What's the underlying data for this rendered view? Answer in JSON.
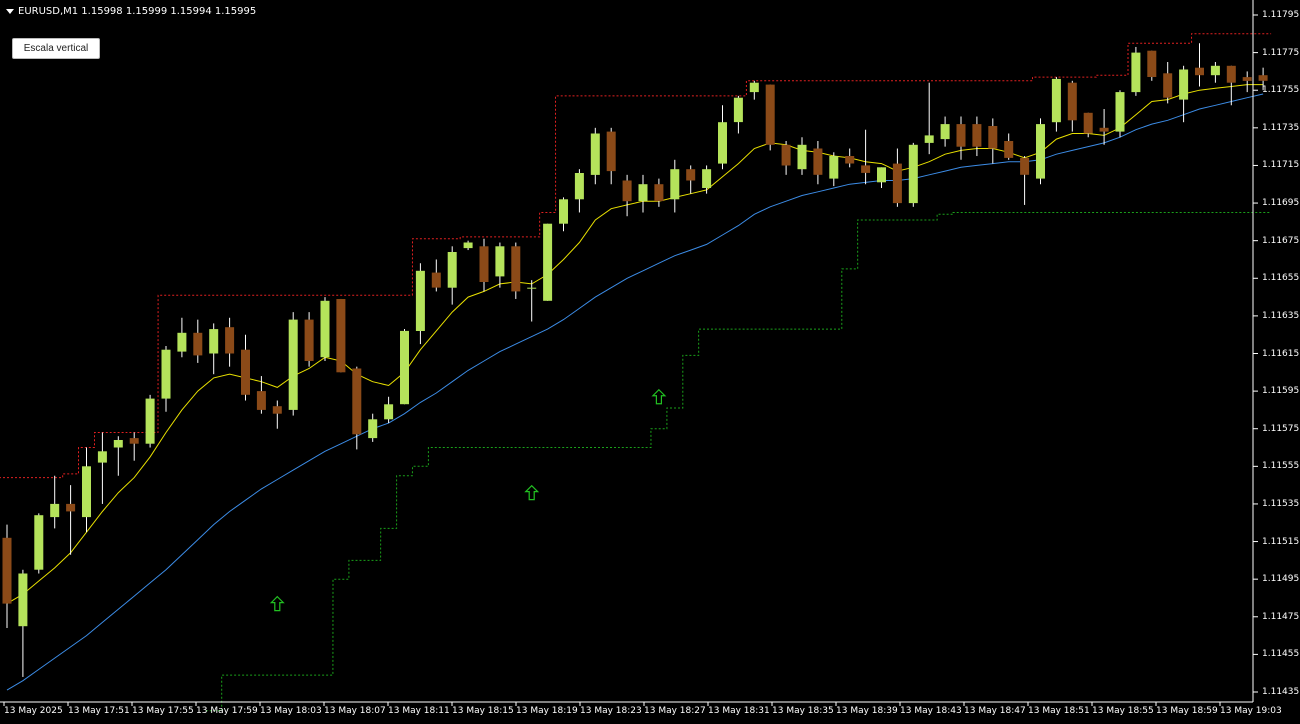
{
  "window": {
    "symbol_header": "EURUSD,M1  1.15998 1.15999 1.15994 1.15995"
  },
  "buttons": {
    "vertical_scale": "Escala vertical"
  },
  "colors": {
    "background": "#000000",
    "bull_candle": "#b5e35b",
    "bear_candle": "#8b4a18",
    "fast_ma": "#e8e000",
    "slow_ma": "#3c8ce6",
    "resistance": "#e02020",
    "support": "#1aa01a",
    "arrow": "#22c022",
    "axis": "#ffffff"
  },
  "price_axis": {
    "labels": [
      "1.11795",
      "1.11775",
      "1.11755",
      "1.11735",
      "1.11715",
      "1.11695",
      "1.11675",
      "1.11655",
      "1.11635",
      "1.11615",
      "1.11595",
      "1.11575",
      "1.11555",
      "1.11535",
      "1.11515",
      "1.11495",
      "1.11475",
      "1.11455",
      "1.11435"
    ]
  },
  "time_axis": {
    "labels": [
      "13 May 2025",
      "13 May 17:51",
      "13 May 17:55",
      "13 May 17:59",
      "13 May 18:03",
      "13 May 18:07",
      "13 May 18:11",
      "13 May 18:15",
      "13 May 18:19",
      "13 May 18:23",
      "13 May 18:27",
      "13 May 18:31",
      "13 May 18:35",
      "13 May 18:39",
      "13 May 18:43",
      "13 May 18:47",
      "13 May 18:51",
      "13 May 18:55",
      "13 May 18:59",
      "13 May 19:03"
    ]
  },
  "chart_data": {
    "type": "candlestick",
    "symbol": "EURUSD",
    "timeframe": "M1",
    "ylim": [
      1.1143,
      1.118
    ],
    "candles": [
      {
        "o": 1.11517,
        "h": 1.11524,
        "l": 1.11469,
        "c": 1.11482
      },
      {
        "o": 1.1147,
        "h": 1.115,
        "l": 1.11443,
        "c": 1.11498
      },
      {
        "o": 1.115,
        "h": 1.1153,
        "l": 1.11498,
        "c": 1.11529
      },
      {
        "o": 1.11528,
        "h": 1.1155,
        "l": 1.11522,
        "c": 1.11535
      },
      {
        "o": 1.11535,
        "h": 1.11545,
        "l": 1.11508,
        "c": 1.11531
      },
      {
        "o": 1.11528,
        "h": 1.11565,
        "l": 1.1152,
        "c": 1.11555
      },
      {
        "o": 1.11557,
        "h": 1.11573,
        "l": 1.11535,
        "c": 1.11563
      },
      {
        "o": 1.11565,
        "h": 1.11571,
        "l": 1.1155,
        "c": 1.11569
      },
      {
        "o": 1.1157,
        "h": 1.11573,
        "l": 1.11558,
        "c": 1.11567
      },
      {
        "o": 1.11567,
        "h": 1.11593,
        "l": 1.11565,
        "c": 1.11591
      },
      {
        "o": 1.11591,
        "h": 1.11619,
        "l": 1.11584,
        "c": 1.11617
      },
      {
        "o": 1.11616,
        "h": 1.11634,
        "l": 1.11613,
        "c": 1.11626
      },
      {
        "o": 1.11626,
        "h": 1.11633,
        "l": 1.1161,
        "c": 1.11614
      },
      {
        "o": 1.11615,
        "h": 1.11631,
        "l": 1.11604,
        "c": 1.11628
      },
      {
        "o": 1.11629,
        "h": 1.11634,
        "l": 1.11608,
        "c": 1.11615
      },
      {
        "o": 1.11617,
        "h": 1.11625,
        "l": 1.1159,
        "c": 1.11593
      },
      {
        "o": 1.11595,
        "h": 1.11603,
        "l": 1.11583,
        "c": 1.11585
      },
      {
        "o": 1.11587,
        "h": 1.1159,
        "l": 1.11575,
        "c": 1.11583
      },
      {
        "o": 1.11585,
        "h": 1.11637,
        "l": 1.11582,
        "c": 1.11633
      },
      {
        "o": 1.11633,
        "h": 1.11637,
        "l": 1.11608,
        "c": 1.11611
      },
      {
        "o": 1.11613,
        "h": 1.11645,
        "l": 1.11611,
        "c": 1.11643
      },
      {
        "o": 1.11644,
        "h": 1.11644,
        "l": 1.11605,
        "c": 1.11605
      },
      {
        "o": 1.11607,
        "h": 1.11608,
        "l": 1.11564,
        "c": 1.11572
      },
      {
        "o": 1.1157,
        "h": 1.11583,
        "l": 1.11568,
        "c": 1.1158
      },
      {
        "o": 1.1158,
        "h": 1.11592,
        "l": 1.11578,
        "c": 1.11588
      },
      {
        "o": 1.11588,
        "h": 1.11628,
        "l": 1.11588,
        "c": 1.11627
      },
      {
        "o": 1.11627,
        "h": 1.11663,
        "l": 1.1162,
        "c": 1.11659
      },
      {
        "o": 1.11658,
        "h": 1.11665,
        "l": 1.11648,
        "c": 1.1165
      },
      {
        "o": 1.1165,
        "h": 1.11672,
        "l": 1.11641,
        "c": 1.11669
      },
      {
        "o": 1.11671,
        "h": 1.11675,
        "l": 1.1167,
        "c": 1.11674
      },
      {
        "o": 1.11672,
        "h": 1.11676,
        "l": 1.11648,
        "c": 1.11653
      },
      {
        "o": 1.11656,
        "h": 1.11674,
        "l": 1.1165,
        "c": 1.11672
      },
      {
        "o": 1.11672,
        "h": 1.11674,
        "l": 1.11644,
        "c": 1.11648
      },
      {
        "o": 1.1165,
        "h": 1.11654,
        "l": 1.11632,
        "c": 1.1165
      },
      {
        "o": 1.11643,
        "h": 1.11684,
        "l": 1.11643,
        "c": 1.11684
      },
      {
        "o": 1.11684,
        "h": 1.11698,
        "l": 1.1168,
        "c": 1.11697
      },
      {
        "o": 1.11697,
        "h": 1.11713,
        "l": 1.1169,
        "c": 1.11711
      },
      {
        "o": 1.1171,
        "h": 1.11735,
        "l": 1.11705,
        "c": 1.11732
      },
      {
        "o": 1.11733,
        "h": 1.11735,
        "l": 1.11705,
        "c": 1.11712
      },
      {
        "o": 1.11707,
        "h": 1.1171,
        "l": 1.11688,
        "c": 1.11696
      },
      {
        "o": 1.11696,
        "h": 1.1171,
        "l": 1.1169,
        "c": 1.11705
      },
      {
        "o": 1.11705,
        "h": 1.11708,
        "l": 1.11693,
        "c": 1.11696
      },
      {
        "o": 1.11697,
        "h": 1.11718,
        "l": 1.1169,
        "c": 1.11713
      },
      {
        "o": 1.11713,
        "h": 1.11715,
        "l": 1.117,
        "c": 1.11707
      },
      {
        "o": 1.11703,
        "h": 1.11715,
        "l": 1.117,
        "c": 1.11713
      },
      {
        "o": 1.11716,
        "h": 1.11747,
        "l": 1.11713,
        "c": 1.11738
      },
      {
        "o": 1.11738,
        "h": 1.11752,
        "l": 1.11732,
        "c": 1.11751
      },
      {
        "o": 1.11754,
        "h": 1.1176,
        "l": 1.1175,
        "c": 1.11759
      },
      {
        "o": 1.11758,
        "h": 1.11758,
        "l": 1.11723,
        "c": 1.11726
      },
      {
        "o": 1.11726,
        "h": 1.11728,
        "l": 1.1171,
        "c": 1.11715
      },
      {
        "o": 1.11713,
        "h": 1.1173,
        "l": 1.1171,
        "c": 1.11726
      },
      {
        "o": 1.11724,
        "h": 1.11728,
        "l": 1.11705,
        "c": 1.1171
      },
      {
        "o": 1.11708,
        "h": 1.11722,
        "l": 1.11704,
        "c": 1.1172
      },
      {
        "o": 1.1172,
        "h": 1.11724,
        "l": 1.11714,
        "c": 1.11716
      },
      {
        "o": 1.11715,
        "h": 1.11734,
        "l": 1.11705,
        "c": 1.11711
      },
      {
        "o": 1.11706,
        "h": 1.11714,
        "l": 1.11703,
        "c": 1.11714
      },
      {
        "o": 1.11716,
        "h": 1.11724,
        "l": 1.11693,
        "c": 1.11695
      },
      {
        "o": 1.11695,
        "h": 1.11727,
        "l": 1.11693,
        "c": 1.11726
      },
      {
        "o": 1.11727,
        "h": 1.11759,
        "l": 1.11721,
        "c": 1.11731
      },
      {
        "o": 1.11729,
        "h": 1.11741,
        "l": 1.11725,
        "c": 1.11737
      },
      {
        "o": 1.11737,
        "h": 1.11741,
        "l": 1.11718,
        "c": 1.11725
      },
      {
        "o": 1.11737,
        "h": 1.11741,
        "l": 1.1172,
        "c": 1.11725
      },
      {
        "o": 1.11736,
        "h": 1.1174,
        "l": 1.11716,
        "c": 1.11724
      },
      {
        "o": 1.11728,
        "h": 1.11732,
        "l": 1.11718,
        "c": 1.11719
      },
      {
        "o": 1.11719,
        "h": 1.1172,
        "l": 1.11694,
        "c": 1.1171
      },
      {
        "o": 1.11708,
        "h": 1.1174,
        "l": 1.11705,
        "c": 1.11737
      },
      {
        "o": 1.11738,
        "h": 1.11762,
        "l": 1.11733,
        "c": 1.11761
      },
      {
        "o": 1.11759,
        "h": 1.1176,
        "l": 1.11733,
        "c": 1.11739
      },
      {
        "o": 1.11743,
        "h": 1.11743,
        "l": 1.1173,
        "c": 1.11732
      },
      {
        "o": 1.11735,
        "h": 1.11745,
        "l": 1.11726,
        "c": 1.11733
      },
      {
        "o": 1.11733,
        "h": 1.11755,
        "l": 1.1173,
        "c": 1.11754
      },
      {
        "o": 1.11754,
        "h": 1.11778,
        "l": 1.11752,
        "c": 1.11775
      },
      {
        "o": 1.11776,
        "h": 1.11776,
        "l": 1.1176,
        "c": 1.11762
      },
      {
        "o": 1.11764,
        "h": 1.1177,
        "l": 1.11748,
        "c": 1.11751
      },
      {
        "o": 1.1175,
        "h": 1.11768,
        "l": 1.11738,
        "c": 1.11766
      },
      {
        "o": 1.11767,
        "h": 1.1178,
        "l": 1.11757,
        "c": 1.11763
      },
      {
        "o": 1.11763,
        "h": 1.1177,
        "l": 1.11759,
        "c": 1.11768
      },
      {
        "o": 1.11768,
        "h": 1.11768,
        "l": 1.11747,
        "c": 1.11759
      },
      {
        "o": 1.11762,
        "h": 1.11765,
        "l": 1.11754,
        "c": 1.1176
      },
      {
        "o": 1.11763,
        "h": 1.11767,
        "l": 1.11755,
        "c": 1.1176
      }
    ],
    "fast_ma": [
      1.11482,
      1.11487,
      1.11494,
      1.11501,
      1.11509,
      1.1152,
      1.11531,
      1.11541,
      1.11549,
      1.1156,
      1.11573,
      1.11585,
      1.11595,
      1.11602,
      1.11604,
      1.11602,
      1.116,
      1.11597,
      1.11603,
      1.11607,
      1.11613,
      1.11611,
      1.11604,
      1.116,
      1.11598,
      1.11605,
      1.11617,
      1.11627,
      1.11637,
      1.11645,
      1.11648,
      1.11652,
      1.11653,
      1.11652,
      1.11657,
      1.11665,
      1.11674,
      1.11686,
      1.11692,
      1.11694,
      1.11696,
      1.11696,
      1.11698,
      1.117,
      1.11702,
      1.11709,
      1.11716,
      1.11724,
      1.11727,
      1.11726,
      1.11723,
      1.11722,
      1.1172,
      1.11719,
      1.11717,
      1.11716,
      1.11712,
      1.11714,
      1.11717,
      1.11721,
      1.11723,
      1.11724,
      1.11724,
      1.11722,
      1.11719,
      1.11722,
      1.11729,
      1.11732,
      1.11732,
      1.11731,
      1.11735,
      1.11742,
      1.11749,
      1.1175,
      1.11753,
      1.11755,
      1.11756,
      1.11757,
      1.11758,
      1.11758
    ],
    "slow_ma": [
      1.11436,
      1.11441,
      1.11447,
      1.11453,
      1.11459,
      1.11465,
      1.11472,
      1.11479,
      1.11486,
      1.11493,
      1.115,
      1.11508,
      1.11516,
      1.11524,
      1.11531,
      1.11537,
      1.11543,
      1.11548,
      1.11553,
      1.11558,
      1.11563,
      1.11567,
      1.11571,
      1.11575,
      1.11578,
      1.11583,
      1.11589,
      1.11594,
      1.116,
      1.11606,
      1.11611,
      1.11616,
      1.1162,
      1.11624,
      1.11628,
      1.11633,
      1.11639,
      1.11645,
      1.1165,
      1.11655,
      1.11659,
      1.11663,
      1.11667,
      1.1167,
      1.11673,
      1.11678,
      1.11683,
      1.11689,
      1.11693,
      1.11696,
      1.11699,
      1.11701,
      1.11703,
      1.11705,
      1.11706,
      1.11707,
      1.11707,
      1.11708,
      1.1171,
      1.11712,
      1.11714,
      1.11715,
      1.11716,
      1.11717,
      1.11717,
      1.11718,
      1.11721,
      1.11723,
      1.11725,
      1.11727,
      1.1173,
      1.11734,
      1.11737,
      1.11739,
      1.11742,
      1.11745,
      1.11747,
      1.11749,
      1.11751,
      1.11753
    ],
    "resistance": [
      1.11549,
      1.11549,
      1.11549,
      1.11549,
      1.11551,
      1.11565,
      1.11573,
      1.11573,
      1.11573,
      1.11573,
      1.11646,
      1.11646,
      1.11646,
      1.11646,
      1.11646,
      1.11646,
      1.11646,
      1.11646,
      1.11646,
      1.11646,
      1.11646,
      1.11646,
      1.11646,
      1.11646,
      1.11646,
      1.11646,
      1.11676,
      1.11676,
      1.11676,
      1.11677,
      1.11677,
      1.11677,
      1.11677,
      1.11677,
      1.1169,
      1.11752,
      1.11752,
      1.11752,
      1.11752,
      1.11752,
      1.11752,
      1.11752,
      1.11752,
      1.11752,
      1.11752,
      1.11752,
      1.11752,
      1.1176,
      1.1176,
      1.1176,
      1.1176,
      1.1176,
      1.1176,
      1.1176,
      1.1176,
      1.1176,
      1.1176,
      1.1176,
      1.1176,
      1.1176,
      1.1176,
      1.1176,
      1.1176,
      1.1176,
      1.1176,
      1.11762,
      1.11762,
      1.11762,
      1.11762,
      1.11763,
      1.11763,
      1.1178,
      1.1178,
      1.1178,
      1.1178,
      1.11785,
      1.11785,
      1.11785,
      1.11785,
      1.11785
    ],
    "support": [
      null,
      null,
      null,
      null,
      null,
      null,
      null,
      null,
      null,
      null,
      null,
      null,
      null,
      1.11425,
      1.11444,
      1.11444,
      1.11444,
      1.11444,
      1.11444,
      1.11444,
      1.11444,
      1.11495,
      1.11505,
      1.11505,
      1.11522,
      1.1155,
      1.11555,
      1.11565,
      1.11565,
      1.11565,
      1.11565,
      1.11565,
      1.11565,
      1.11565,
      1.11565,
      1.11565,
      1.11565,
      1.11565,
      1.11565,
      1.11565,
      1.11565,
      1.11575,
      1.11586,
      1.11614,
      1.11628,
      1.11628,
      1.11628,
      1.11628,
      1.11628,
      1.11628,
      1.11628,
      1.11628,
      1.11628,
      1.1166,
      1.11686,
      1.11686,
      1.11686,
      1.11686,
      1.11686,
      1.11689,
      1.1169,
      1.1169,
      1.1169,
      1.1169,
      1.1169,
      1.1169,
      1.1169,
      1.1169,
      1.1169,
      1.1169,
      1.1169,
      1.1169,
      1.1169,
      1.1169,
      1.1169,
      1.1169,
      1.1169,
      1.1169,
      1.1169,
      1.1169
    ],
    "arrows": [
      {
        "index": 17,
        "price": 1.11482
      },
      {
        "index": 33,
        "price": 1.11541
      },
      {
        "index": 41,
        "price": 1.11592
      }
    ]
  }
}
